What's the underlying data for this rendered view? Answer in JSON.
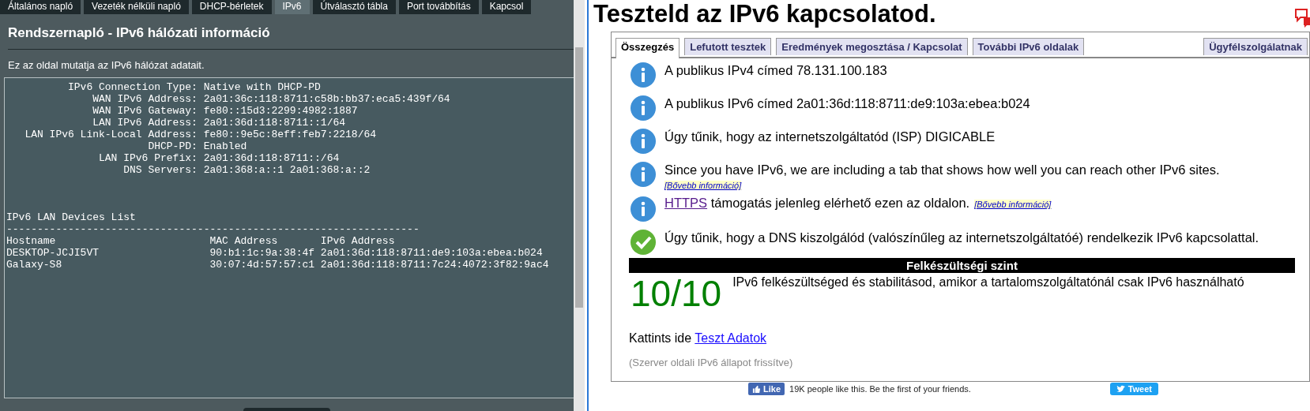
{
  "router_page": {
    "tabs": [
      {
        "label": "Általános napló",
        "selected": false
      },
      {
        "label": "Vezeték nélküli napló",
        "selected": false
      },
      {
        "label": "DHCP-bérletek",
        "selected": false
      },
      {
        "label": "IPv6",
        "selected": true
      },
      {
        "label": "Útválasztó tábla",
        "selected": false
      },
      {
        "label": "Port továbbítás",
        "selected": false
      },
      {
        "label": "Kapcsol",
        "selected": false
      }
    ],
    "title": "Rendszernapló - IPv6 hálózati információ",
    "description": "Ez az oldal mutatja az IPv6 hálózat adatait.",
    "log": {
      "connection": [
        {
          "label": "IPv6 Connection Type:",
          "value": "Native with DHCP-PD"
        },
        {
          "label": "WAN IPv6 Address:",
          "value": "2a01:36c:118:8711:c58b:bb37:eca5:439f/64"
        },
        {
          "label": "WAN IPv6 Gateway:",
          "value": "fe80::15d3:2299:4982:1887"
        },
        {
          "label": "LAN IPv6 Address:",
          "value": "2a01:36d:118:8711::1/64"
        },
        {
          "label": "LAN IPv6 Link-Local Address:",
          "value": "fe80::9e5c:8eff:feb7:2218/64"
        },
        {
          "label": "DHCP-PD:",
          "value": "Enabled"
        },
        {
          "label": "LAN IPv6 Prefix:",
          "value": "2a01:36d:118:8711::/64"
        },
        {
          "label": "DNS Servers:",
          "value": "2a01:368:a::1 2a01:368:a::2"
        }
      ],
      "devices_title": "IPv6 LAN Devices List",
      "separator": "-------------------------------------------------------------------",
      "columns": [
        "Hostname",
        "MAC Address",
        "IPv6 Address"
      ],
      "rows": [
        [
          "DESKTOP-JCJI5VT",
          "90:b1:1c:9a:38:4f",
          "2a01:36d:118:8711:de9:103a:ebea:b024"
        ],
        [
          "Galaxy-S8",
          "30:07:4d:57:57:c1",
          "2a01:36d:118:8711:7c24:4072:3f82:9ac4"
        ]
      ]
    }
  },
  "test_page": {
    "title": "Teszteld az IPv6 kapcsolatod.",
    "tabs": [
      {
        "label": "Összegzés",
        "selected": true
      },
      {
        "label": "Lefutott tesztek",
        "selected": false
      },
      {
        "label": "Eredmények megosztása / Kapcsolat",
        "selected": false
      },
      {
        "label": "További IPv6 oldalak",
        "selected": false
      },
      {
        "label": "Ügyfélszolgálatnak",
        "selected": false
      }
    ],
    "results": [
      {
        "kind": "info",
        "text": "A publikus IPv4 címed 78.131.100.183"
      },
      {
        "kind": "info",
        "text": "A publikus IPv6 címed 2a01:36d:118:8711:de9:103a:ebea:b024"
      },
      {
        "kind": "info",
        "text": "Úgy tűnik, hogy az internetszolgáltatód (ISP) DIGICABLE"
      },
      {
        "kind": "info",
        "text": "Since you have IPv6, we are including a tab that shows how well you can reach other IPv6 sites.",
        "more": "[Bővebb információ]"
      },
      {
        "kind": "info",
        "link": "HTTPS",
        "text": "támogatás jelenleg elérhető ezen az oldalon.",
        "more": "[Bővebb információ]"
      },
      {
        "kind": "ok",
        "text": "Úgy tűnik, hogy a DNS kiszolgálód (valószínűleg az internetszolgáltatóé) rendelkezik IPv6 kapcsolattal."
      }
    ],
    "readiness": {
      "heading": "Felkészültségi szint",
      "score": "10/10",
      "description": "IPv6 felkészültséged és stabilitásod, amikor a tartalomszolgáltatónál csak IPv6 használható"
    },
    "details": {
      "prompt": "Kattints ide",
      "link": "Teszt Adatok"
    },
    "status": "(Szerver oldali IPv6 állapot frissítve)",
    "social": {
      "like": "Like",
      "like_text": "19K people like this. Be the first of your friends.",
      "tweet": "Tweet"
    }
  }
}
